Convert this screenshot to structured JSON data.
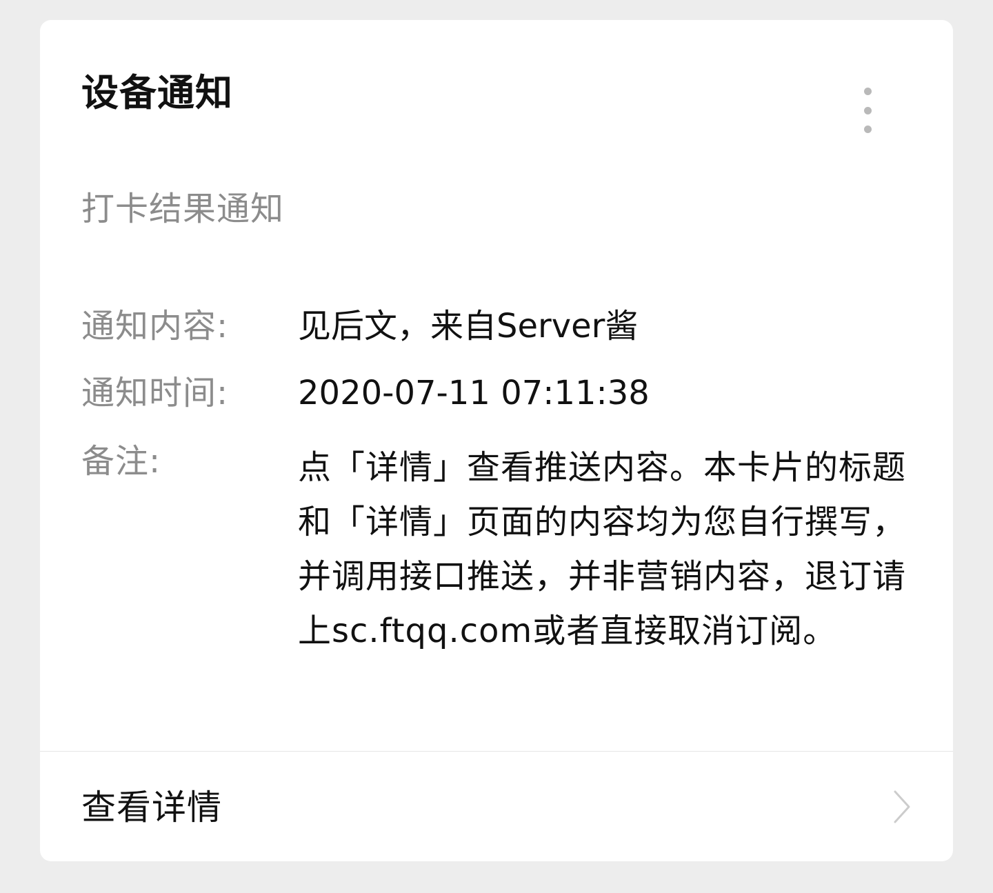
{
  "card": {
    "title": "设备通知",
    "subtitle": "打卡结果通知",
    "more_icon": "more-vertical-icon",
    "fields": [
      {
        "label": "通知内容:",
        "value": "见后文，来自Server酱"
      },
      {
        "label": "通知时间:",
        "value": "2020-07-11 07:11:38"
      }
    ],
    "remark": {
      "label": "备注:",
      "value": "点「详情」查看推送内容。本卡片的标题和「详情」页面的内容均为您自行撰写，并调用接口推送，并非营销内容，退订请上sc.ftqq.com或者直接取消订阅。"
    },
    "detail_link": {
      "label": "查看详情",
      "icon": "chevron-right-icon"
    }
  },
  "colors": {
    "background": "#ededed",
    "card": "#ffffff",
    "primary_text": "#111111",
    "secondary_text": "#8c8c8c",
    "icon_gray": "#b9b9b9",
    "chevron": "#cccccc",
    "divider": "#e6e6e6"
  }
}
